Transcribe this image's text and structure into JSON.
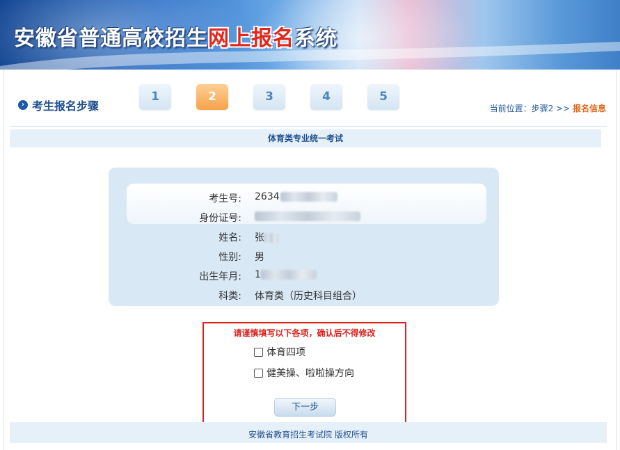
{
  "banner": {
    "title_part1": "安徽省普通高校招生",
    "title_highlight": "网上报名",
    "title_part2": "系统"
  },
  "steps": {
    "title": "考生报名步骤",
    "items": [
      "1",
      "2",
      "3",
      "4",
      "5"
    ],
    "active_index": 1
  },
  "location": {
    "prefix": "当前位置：步骤2 >> ",
    "current": "报名信息"
  },
  "section_title": "体育类专业统一考试",
  "info": {
    "rows": [
      {
        "label": "考生号:",
        "value": "2634"
      },
      {
        "label": "身份证号:",
        "value": ""
      },
      {
        "label": "姓名:",
        "value": "张"
      },
      {
        "label": "性别:",
        "value": "男"
      },
      {
        "label": "出生年月:",
        "value": "1"
      },
      {
        "label": "科类:",
        "value": "体育类（历史科目组合）"
      }
    ]
  },
  "form": {
    "warning": "请谨慎填写以下各项，确认后不得修改",
    "options": [
      "体育四项",
      "健美操、啦啦操方向"
    ],
    "next_button": "下一步"
  },
  "footer": "安徽省教育招生考试院 版权所有",
  "colors": {
    "accent_blue": "#1f4f8f",
    "active_step": "#f6a24a",
    "warning_red": "#d9221f"
  }
}
